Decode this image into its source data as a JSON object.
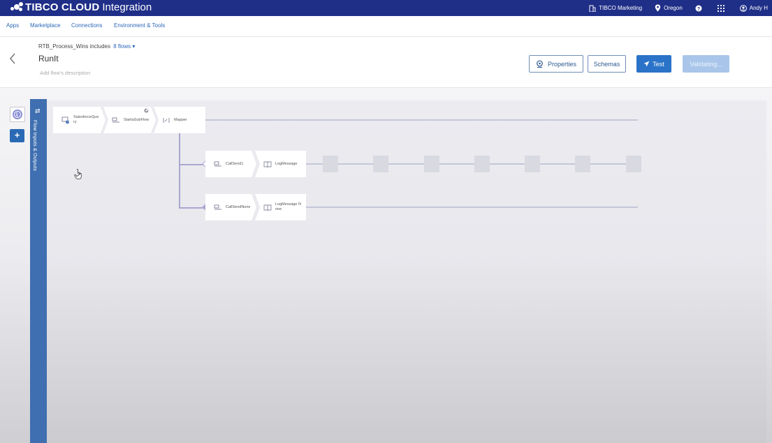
{
  "topbar": {
    "brand_bold": "TIBCO CLOUD",
    "brand_light": "Integration",
    "org": "TIBCO Marketing",
    "region": "Oregon",
    "user": "Andy H"
  },
  "nav": {
    "items": [
      "Apps",
      "Marketplace",
      "Connections",
      "Environment & Tools"
    ]
  },
  "header": {
    "breadcrumb_prefix": "RTB_Process_Wins includes",
    "breadcrumb_flows": "8 flows ▾",
    "title": "RunIt",
    "description_placeholder": "Add flow's description",
    "buttons": {
      "properties": "Properties",
      "schemas": "Schemas",
      "test": "Test",
      "validating": "Validating..."
    }
  },
  "side_panel": {
    "label": "Flow Inputs & Outputs"
  },
  "flow": {
    "main_row": [
      "SalesforceQuery",
      "StartaSubFlow",
      "Mapper"
    ],
    "branch1": [
      "CallSend1",
      "LogMessage"
    ],
    "branch2": [
      "CallSendNone",
      "LogMessage None"
    ],
    "empty_slots": 7
  },
  "colors": {
    "topbar": "#1f2f88",
    "accent": "#2a73c8",
    "side_panel": "#3f6fb0"
  }
}
